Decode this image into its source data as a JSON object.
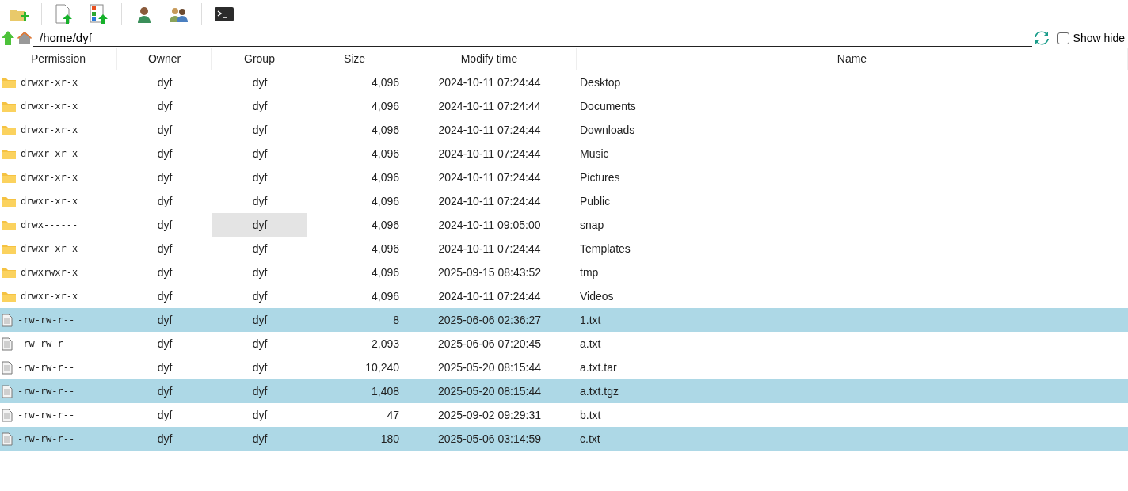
{
  "path_bar": {
    "path": "/home/dyf",
    "show_hide": {
      "label": "Show hide",
      "checked": false
    }
  },
  "table": {
    "columns": [
      "Permission",
      "Owner",
      "Group",
      "Size",
      "Modify time",
      "Name"
    ],
    "rows": [
      {
        "kind": "folder",
        "permission": "drwxr-xr-x",
        "owner": "dyf",
        "group": "dyf",
        "size": "4,096",
        "modified": "2024-10-11 07:24:44",
        "name": "Desktop",
        "selected": false,
        "group_hovered": false
      },
      {
        "kind": "folder",
        "permission": "drwxr-xr-x",
        "owner": "dyf",
        "group": "dyf",
        "size": "4,096",
        "modified": "2024-10-11 07:24:44",
        "name": "Documents",
        "selected": false,
        "group_hovered": false
      },
      {
        "kind": "folder",
        "permission": "drwxr-xr-x",
        "owner": "dyf",
        "group": "dyf",
        "size": "4,096",
        "modified": "2024-10-11 07:24:44",
        "name": "Downloads",
        "selected": false,
        "group_hovered": false
      },
      {
        "kind": "folder",
        "permission": "drwxr-xr-x",
        "owner": "dyf",
        "group": "dyf",
        "size": "4,096",
        "modified": "2024-10-11 07:24:44",
        "name": "Music",
        "selected": false,
        "group_hovered": false
      },
      {
        "kind": "folder",
        "permission": "drwxr-xr-x",
        "owner": "dyf",
        "group": "dyf",
        "size": "4,096",
        "modified": "2024-10-11 07:24:44",
        "name": "Pictures",
        "selected": false,
        "group_hovered": false
      },
      {
        "kind": "folder",
        "permission": "drwxr-xr-x",
        "owner": "dyf",
        "group": "dyf",
        "size": "4,096",
        "modified": "2024-10-11 07:24:44",
        "name": "Public",
        "selected": false,
        "group_hovered": false
      },
      {
        "kind": "folder",
        "permission": "drwx------",
        "owner": "dyf",
        "group": "dyf",
        "size": "4,096",
        "modified": "2024-10-11 09:05:00",
        "name": "snap",
        "selected": false,
        "group_hovered": true
      },
      {
        "kind": "folder",
        "permission": "drwxr-xr-x",
        "owner": "dyf",
        "group": "dyf",
        "size": "4,096",
        "modified": "2024-10-11 07:24:44",
        "name": "Templates",
        "selected": false,
        "group_hovered": false
      },
      {
        "kind": "folder",
        "permission": "drwxrwxr-x",
        "owner": "dyf",
        "group": "dyf",
        "size": "4,096",
        "modified": "2025-09-15 08:43:52",
        "name": "tmp",
        "selected": false,
        "group_hovered": false
      },
      {
        "kind": "folder",
        "permission": "drwxr-xr-x",
        "owner": "dyf",
        "group": "dyf",
        "size": "4,096",
        "modified": "2024-10-11 07:24:44",
        "name": "Videos",
        "selected": false,
        "group_hovered": false
      },
      {
        "kind": "file",
        "permission": "-rw-rw-r--",
        "owner": "dyf",
        "group": "dyf",
        "size": "8",
        "modified": "2025-06-06 02:36:27",
        "name": "1.txt",
        "selected": true,
        "group_hovered": false
      },
      {
        "kind": "file",
        "permission": "-rw-rw-r--",
        "owner": "dyf",
        "group": "dyf",
        "size": "2,093",
        "modified": "2025-06-06 07:20:45",
        "name": "a.txt",
        "selected": false,
        "group_hovered": false
      },
      {
        "kind": "file",
        "permission": "-rw-rw-r--",
        "owner": "dyf",
        "group": "dyf",
        "size": "10,240",
        "modified": "2025-05-20 08:15:44",
        "name": "a.txt.tar",
        "selected": false,
        "group_hovered": false
      },
      {
        "kind": "file",
        "permission": "-rw-rw-r--",
        "owner": "dyf",
        "group": "dyf",
        "size": "1,408",
        "modified": "2025-05-20 08:15:44",
        "name": "a.txt.tgz",
        "selected": true,
        "group_hovered": false
      },
      {
        "kind": "file",
        "permission": "-rw-rw-r--",
        "owner": "dyf",
        "group": "dyf",
        "size": "47",
        "modified": "2025-09-02 09:29:31",
        "name": "b.txt",
        "selected": false,
        "group_hovered": false
      },
      {
        "kind": "file",
        "permission": "-rw-rw-r--",
        "owner": "dyf",
        "group": "dyf",
        "size": "180",
        "modified": "2025-05-06 03:14:59",
        "name": "c.txt",
        "selected": true,
        "group_hovered": false
      }
    ]
  }
}
